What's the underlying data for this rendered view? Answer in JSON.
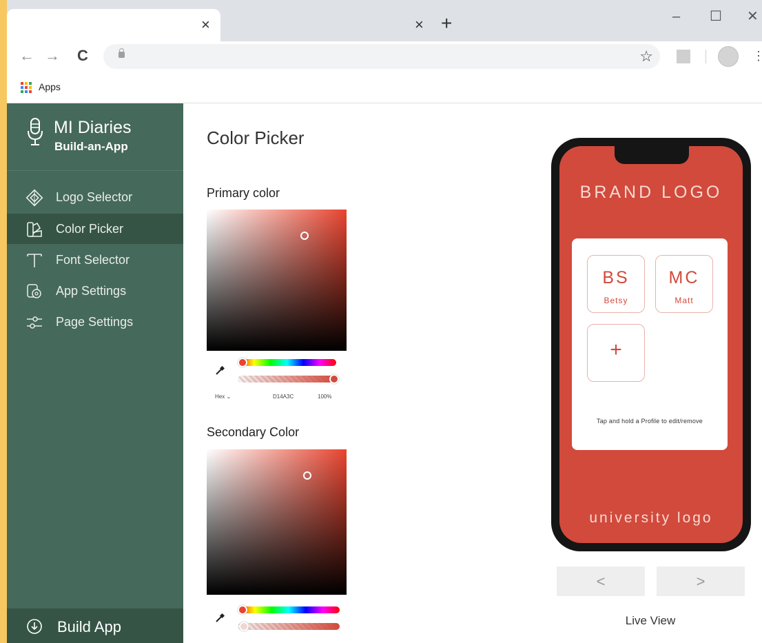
{
  "browser": {
    "apps_label": "Apps",
    "new_tab_symbol": "+",
    "close_symbol": "×",
    "minimize_symbol": "–",
    "maximize_symbol": "☐",
    "window_close_symbol": "✕",
    "back_symbol": "←",
    "forward_symbol": "→",
    "reload_symbol": "C",
    "star_symbol": "☆",
    "menu_symbol": "⋮"
  },
  "sidebar": {
    "title": "MI Diaries",
    "subtitle": "Build-an-App",
    "items": [
      {
        "label": "Logo Selector",
        "icon": "diamond-logo-icon",
        "active": false
      },
      {
        "label": "Color Picker",
        "icon": "palette-icon",
        "active": true
      },
      {
        "label": "Font Selector",
        "icon": "font-icon",
        "active": false
      },
      {
        "label": "App Settings",
        "icon": "gear-icon",
        "active": false
      },
      {
        "label": "Page Settings",
        "icon": "sliders-icon",
        "active": false
      }
    ],
    "build_label": "Build App"
  },
  "main": {
    "title": "Color Picker",
    "primary": {
      "label": "Primary color",
      "format": "Hex",
      "hex": "D14A3C",
      "opacity": "100%",
      "hue_color": "#e8442f"
    },
    "secondary": {
      "label": "Secondary Color",
      "hue_color": "#e8442f"
    }
  },
  "preview": {
    "brand_logo": "BRAND LOGO",
    "profiles": [
      {
        "initials": "BS",
        "name": "Betsy"
      },
      {
        "initials": "MC",
        "name": "Matt"
      }
    ],
    "add_symbol": "+",
    "hint": "Tap and hold a Profile to edit/remove",
    "university_logo": "university logo",
    "prev_symbol": "<",
    "next_symbol": ">",
    "live_view_label": "Live View"
  },
  "colors": {
    "sidebar_bg": "#45695a",
    "sidebar_active": "#355445",
    "accent": "#d14a3c",
    "page_bg": "#f6c85f"
  }
}
